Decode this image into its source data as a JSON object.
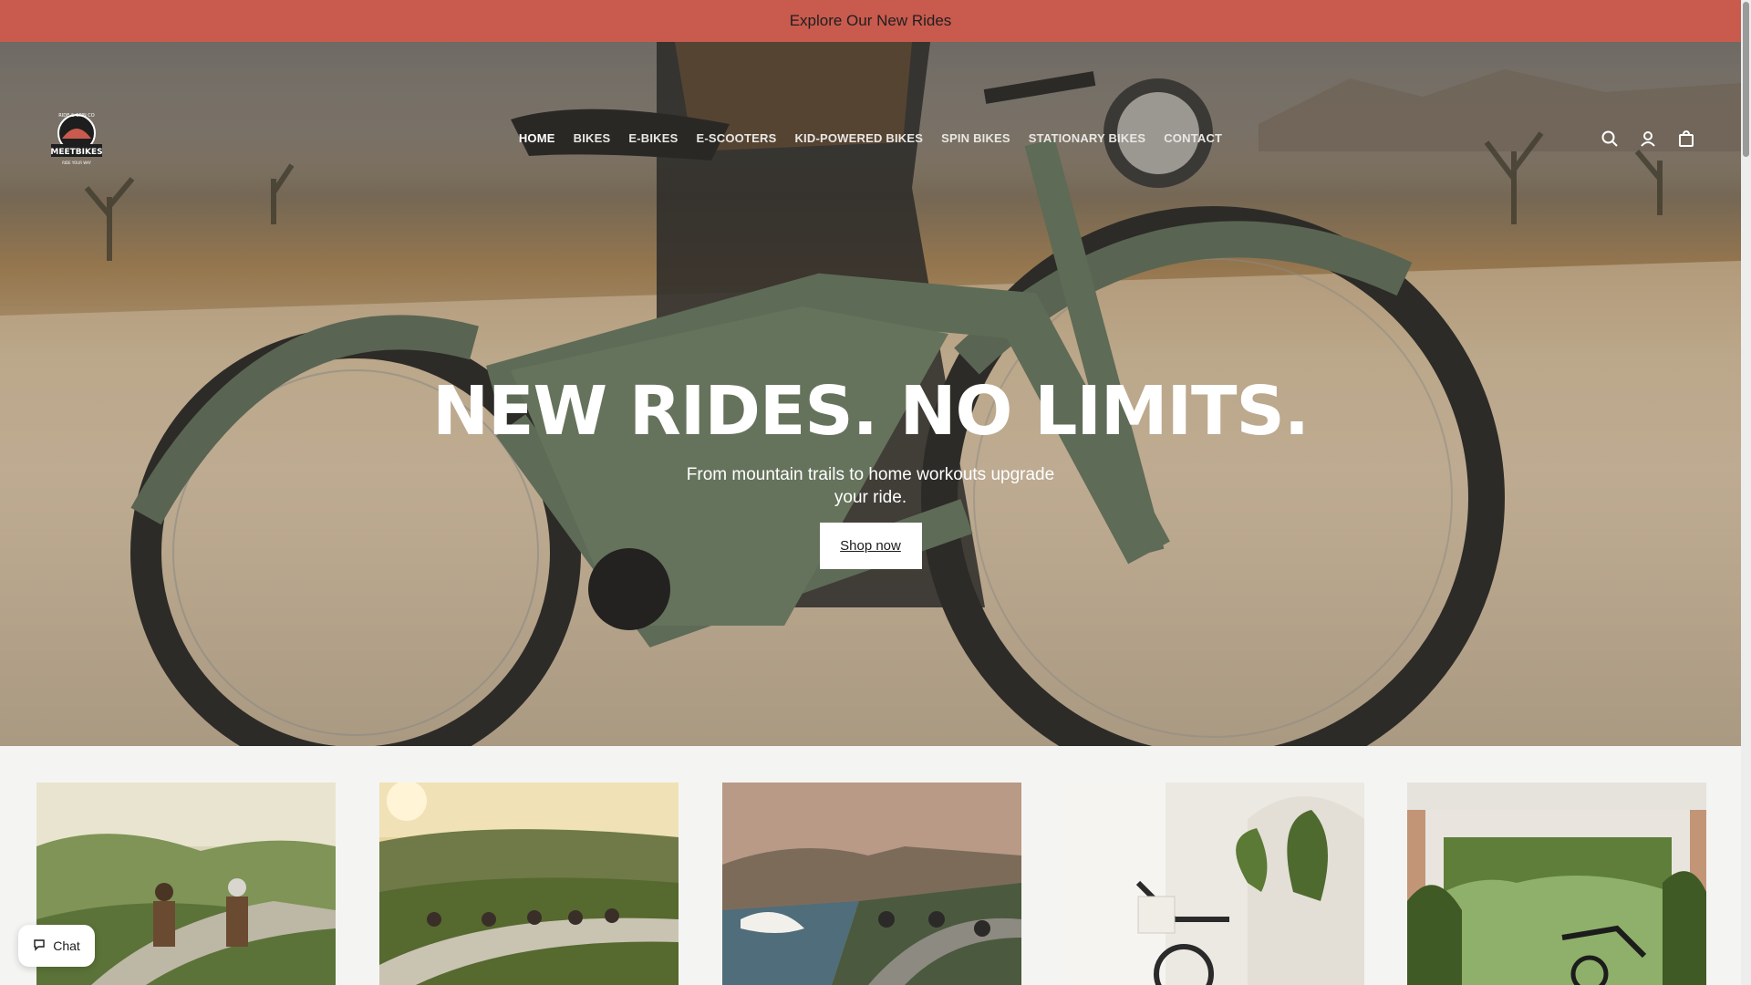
{
  "announcement": {
    "text": "Explore Our New Rides"
  },
  "logo": {
    "brand_top": "RIDE & SPIN CO",
    "brand_name": "MEETBIKES",
    "tagline": "RIDE YOUR WAY"
  },
  "nav": {
    "items": [
      {
        "label": "HOME",
        "active": true
      },
      {
        "label": "BIKES"
      },
      {
        "label": "E-BIKES"
      },
      {
        "label": "E-SCOOTERS"
      },
      {
        "label": "KID-POWERED BIKES"
      },
      {
        "label": "SPIN BIKES"
      },
      {
        "label": "STATIONARY BIKES"
      },
      {
        "label": "CONTACT"
      }
    ]
  },
  "header_icons": [
    "search-icon",
    "account-icon",
    "cart-icon"
  ],
  "hero": {
    "title": "NEW RIDES. NO LIMITS.",
    "subtitle": "From mountain trails to home workouts upgrade your ride.",
    "cta": "Shop now"
  },
  "cards": [
    {
      "scene": "couple-riding-electric-scooters-meadow"
    },
    {
      "scene": "group-cycling-valley-road-sunset"
    },
    {
      "scene": "cyclists-coastal-road-waves"
    },
    {
      "scene": "spin-bike-bright-room-plants"
    },
    {
      "scene": "stationary-bike-garage-garden"
    }
  ],
  "chat": {
    "label": "Chat"
  },
  "colors": {
    "announcement_bg": "#c85a4e",
    "button_bg": "#ffffff",
    "page_bg": "#f4f4f2"
  }
}
